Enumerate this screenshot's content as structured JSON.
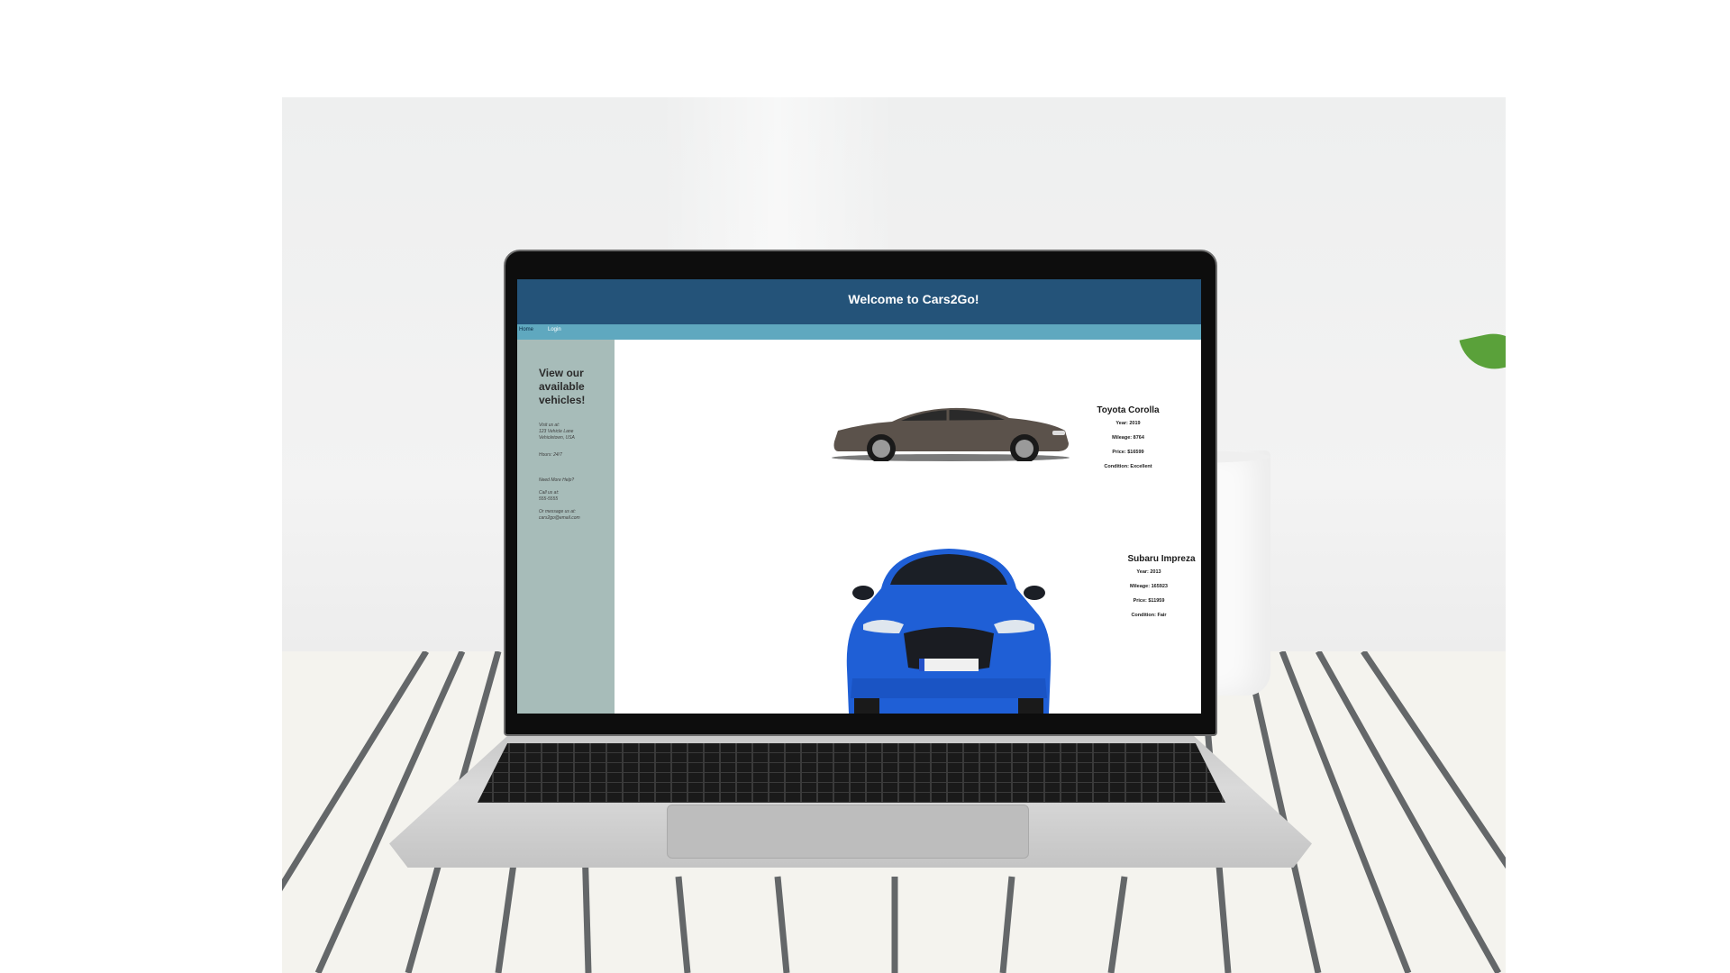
{
  "site": {
    "header_title": "Welcome to Cars2Go!",
    "nav": [
      {
        "label": "Home"
      },
      {
        "label": "Login"
      }
    ]
  },
  "sidebar": {
    "title": "View our available vehicles!",
    "visit_label": "Visit us at:",
    "address_line1": "123 Vehicle Lane",
    "address_line2": "Vehicletown, USA",
    "hours": "Hours: 24/7",
    "help_label": "Need More Help?",
    "call_label": "Call us at:",
    "phone": "555-5555",
    "message_label": "Or message us at:",
    "email": "cars2go@email.com"
  },
  "vehicles": [
    {
      "name": "Toyota Corolla",
      "year": "Year: 2019",
      "mileage": "Mileage: 8764",
      "price": "Price: $16599",
      "condition": "Condition: Excellent",
      "color": "#5b524b"
    },
    {
      "name": "Subaru Impreza",
      "year": "Year: 2013",
      "mileage": "Mileage: 165923",
      "price": "Price: $11959",
      "condition": "Condition: Fair",
      "color": "#1f5fd6"
    }
  ]
}
